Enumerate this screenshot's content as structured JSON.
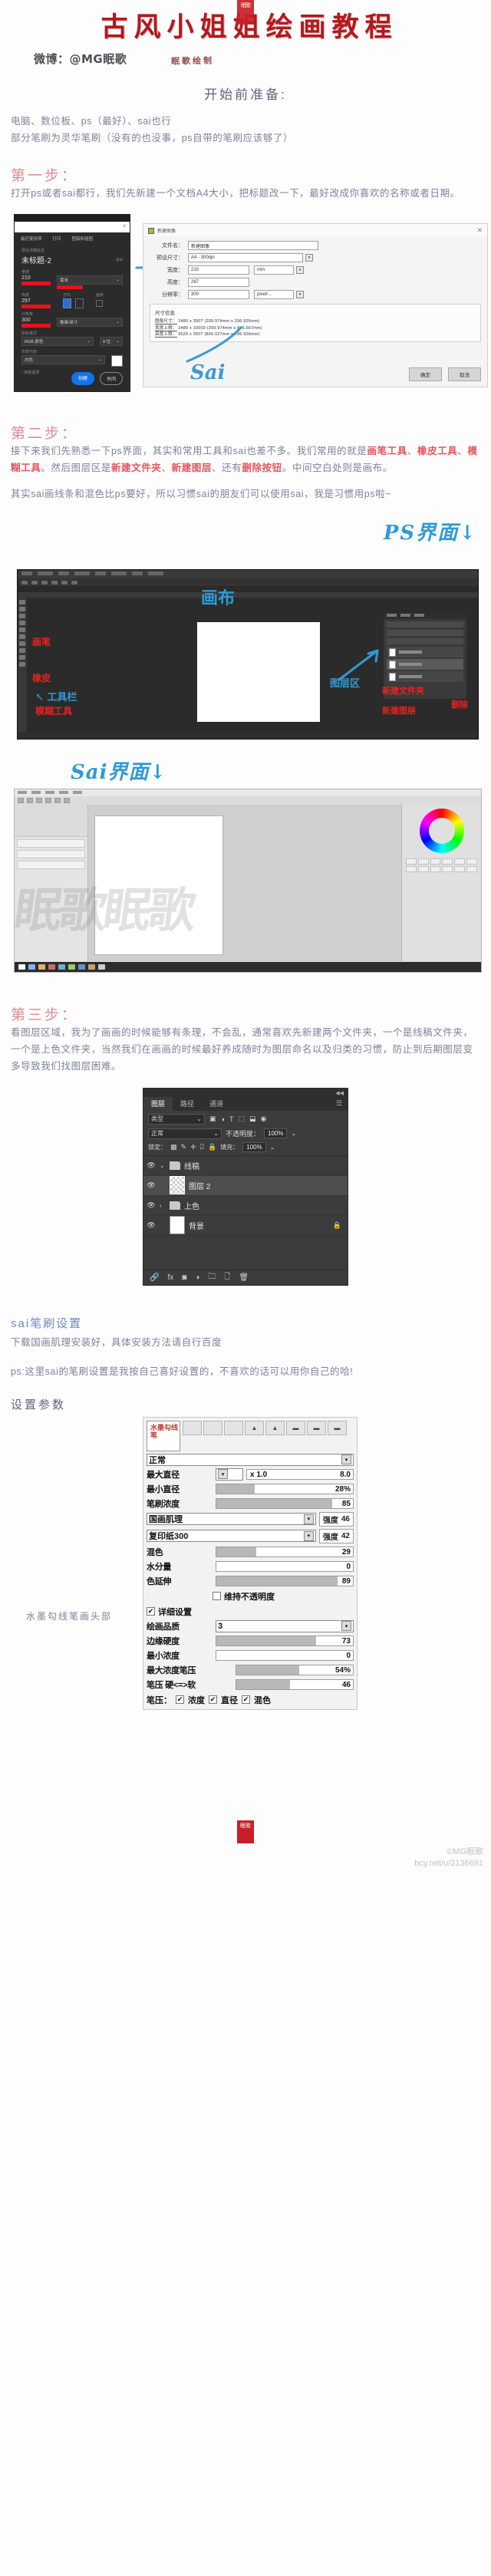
{
  "header": {
    "seal_text": "眠歌",
    "title": "古风小姐姐绘画教程",
    "weibo": "微博：@MG眠歌",
    "hand_stamp": "眠歌绘制"
  },
  "prep": {
    "heading": "开始前准备:",
    "line1": "电脑、数位板、ps（最好）、sai也行",
    "line2": "部分笔刷为灵华笔刷（没有的也没事，ps自带的笔刷应该够了）"
  },
  "step1": {
    "heading": "第一步：",
    "body": "打开ps或者sai都行，我们先新建一个文档A4大小，把标题改一下，最好改成你喜欢的名称或者日期。"
  },
  "ps_new_doc": {
    "hand_label": "PS",
    "title_tabs": [
      "最近使用项",
      "已保存",
      "照片",
      "打印",
      "图稿和插图"
    ],
    "preset_label": "预设详细信息",
    "doc_name": "未标题-2",
    "unit_mini": "毫米",
    "width_label": "宽度",
    "width_value": "210",
    "width_unit": "毫米",
    "height_label": "高度",
    "height_value": "297",
    "orientation_label": "方向",
    "artboard_label": "画板",
    "resolution_label": "分辨率",
    "resolution_value": "300",
    "resolution_unit": "像素/英寸",
    "colormode_label": "颜色模式",
    "colormode_value": "RGB 颜色",
    "bitdepth_value": "8 位",
    "background_label": "背景内容",
    "background_value": "白色",
    "advanced_label": "高级选项",
    "create_button": "创建",
    "close_button": "关闭"
  },
  "sai_new_doc": {
    "hand_label": "Sai",
    "window_title": "新建图像",
    "filename_label": "文件名：",
    "filename_value": "新建图像",
    "preset_label": "预设尺寸：",
    "preset_value": "A4 - 300dpi",
    "width_label": "宽度：",
    "width_value": "210",
    "height_label": "高度：",
    "height_value": "297",
    "unit_value": "mm",
    "resolution_label": "分辨率：",
    "resolution_value": "300",
    "resolution_unit": "pixel/...",
    "sizeinfo_title": "尺寸信息",
    "sizeinfo_rows": [
      {
        "label": "图像尺寸：",
        "value": "2480 x 3507 (209.974mm x 296.926mm)"
      },
      {
        "label": "宽度上限：",
        "value": "2480 x 10000 (209.974mm x 846.667mm)"
      },
      {
        "label": "高度上限：",
        "value": "9520 x 3507 (806.027mm x 296.926mm)"
      }
    ],
    "ok_button": "确定",
    "cancel_button": "取消"
  },
  "step2": {
    "heading": "第二步：",
    "body_a": "接下来我们先熟悉一下ps界面，其实和常用工具和sai也差不多。我们常用的就是",
    "hl_1": "画笔工具",
    "sep_1": "、",
    "hl_2": "橡皮工具",
    "sep_2": "、",
    "hl_3": "模糊工具",
    "body_b": "。然后图层区是",
    "hl_4": "新建文件夹",
    "sep_3": "、",
    "hl_5": "新建图层",
    "sep_4": "、还有",
    "hl_6": "删除按钮",
    "body_c": "。中间空白处则是画布。",
    "note": "其实sai画线条和混色比ps要好，所以习惯sai的朋友们可以使用sai，我是习惯用ps啦~"
  },
  "ps_ui": {
    "hand_title": "PS界面↓",
    "canvas_label": "画布",
    "ann_brush": "画笔",
    "ann_eraser": "橡皮",
    "ann_blur": "模糊工具",
    "ann_toolbar": "工具栏",
    "ann_layerzone": "图层区",
    "ann_new_folder": "新建文件夹",
    "ann_new_layer": "新建图层",
    "ann_delete": "删除"
  },
  "sai_ui": {
    "hand_title": "Sai界面↓",
    "watermark": "眠歌眠歌"
  },
  "step3": {
    "heading": "第三步：",
    "body": "看图层区域，我为了画画的时候能够有条理，不会乱，通常喜欢先新建两个文件夹，一个是线稿文件夹，一个是上色文件夹，当然我们在画画的时候最好养成随时为图层命名以及归类的习惯，防止到后期图层变多导致我们找图层困难。"
  },
  "layers_panel": {
    "tabs": [
      "图层",
      "路径",
      "通道"
    ],
    "active_tab": "图层",
    "filter_value": "类型",
    "filter_icons": [
      "image-filter-icon",
      "adjustment-filter-icon",
      "type-filter-icon",
      "shape-filter-icon",
      "smart-object-filter-icon"
    ],
    "blend_mode": "正常",
    "opacity_label": "不透明度：",
    "opacity_value": "100%",
    "lock_label": "锁定：",
    "fill_label": "填充：",
    "fill_value": "100%",
    "lock_icons": [
      "transparency-lock-icon",
      "brush-lock-icon",
      "move-lock-icon",
      "artboard-lock-icon",
      "all-lock-icon"
    ],
    "items": [
      {
        "name": "线稿",
        "type": "folder",
        "expanded": true,
        "selected": false
      },
      {
        "name": "图层 2",
        "type": "layer",
        "thumb": "transparent",
        "selected": true
      },
      {
        "name": "上色",
        "type": "folder",
        "expanded": false,
        "selected": false
      },
      {
        "name": "背景",
        "type": "layer",
        "thumb": "white",
        "selected": false,
        "locked": true
      }
    ],
    "bottom_icons": [
      "link-icon",
      "fx-icon",
      "mask-icon",
      "adjustment-icon",
      "new-folder-icon",
      "new-layer-icon",
      "delete-icon"
    ]
  },
  "brush_intro": {
    "heading": "sai笔刷设置",
    "line1": "下载国画肌理安装好，具体安装方法请自行百度",
    "line2": "ps:这里sai的笔刷设置是我按自己喜好设置的，不喜欢的话可以用你自己的哈!",
    "params_heading": "设置参数"
  },
  "brush_panel": {
    "preview_text": "水墨勾线笔",
    "shape_cells": [
      "",
      "",
      "",
      "▲",
      "▲",
      "▬",
      "▬",
      "▬"
    ],
    "blend_mode": "正常",
    "rows": [
      {
        "label": "最大直径",
        "type": "multiplier",
        "mult": "x 1.0",
        "value": "8.0"
      },
      {
        "label": "最小直径",
        "type": "slider",
        "value": "28%",
        "pct": 28
      },
      {
        "label": "笔刷浓度",
        "type": "slider",
        "value": "85",
        "pct": 85
      },
      {
        "label": "国画肌理",
        "type": "select-strength",
        "strength_label": "强度",
        "strength": "46"
      },
      {
        "label": "复印纸300",
        "type": "select-strength",
        "strength_label": "强度",
        "strength": "42"
      },
      {
        "label": "混色",
        "type": "slider",
        "value": "29",
        "pct": 29
      },
      {
        "label": "水分量",
        "type": "slider",
        "value": "0",
        "pct": 0
      },
      {
        "label": "色延伸",
        "type": "slider",
        "value": "89",
        "pct": 89
      }
    ],
    "keep_opacity_label": "维持不透明度",
    "keep_opacity_checked": false,
    "detail_label": "详细设置",
    "detail_checked": true,
    "quality_label": "绘画品质",
    "quality_value": "3",
    "detail_rows": [
      {
        "label": "边缘硬度",
        "value": "73",
        "pct": 73
      },
      {
        "label": "最小浓度",
        "value": "0",
        "pct": 0
      },
      {
        "label": "最大浓度笔压",
        "value": "54%",
        "pct": 54
      },
      {
        "label": "笔压 硬<=>软",
        "value": "46",
        "pct": 46
      }
    ],
    "pressure_label": "笔压：",
    "pressure_options": [
      {
        "label": "浓度",
        "checked": true
      },
      {
        "label": "直径",
        "checked": true
      },
      {
        "label": "混色",
        "checked": true
      }
    ],
    "caption": "水墨勾线笔画头部",
    "seal": "眠歌"
  },
  "footer": {
    "watermark_line1": "©MG眠歌",
    "watermark_line2": "bcy.net/u/2136691"
  }
}
